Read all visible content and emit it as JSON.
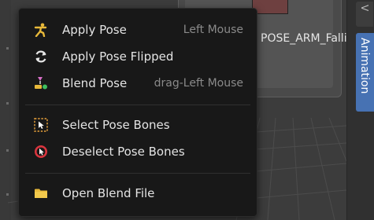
{
  "background": {
    "asset_label": "POSE_ARM_Falling",
    "sidebar_tabs": [
      {
        "label": "V"
      },
      {
        "label": "Animation"
      }
    ]
  },
  "menu": {
    "items": [
      {
        "label": "Apply Pose",
        "shortcut": "Left Mouse",
        "icon": "apply-pose-icon"
      },
      {
        "label": "Apply Pose Flipped",
        "shortcut": "",
        "icon": "flip-icon"
      },
      {
        "label": "Blend Pose",
        "shortcut": "drag-Left Mouse",
        "icon": "blend-pose-icon"
      },
      {
        "label": "Select Pose Bones",
        "shortcut": "",
        "icon": "select-bones-icon"
      },
      {
        "label": "Deselect Pose Bones",
        "shortcut": "",
        "icon": "deselect-bones-icon"
      },
      {
        "label": "Open Blend File",
        "shortcut": "",
        "icon": "folder-icon"
      }
    ]
  },
  "colors": {
    "menu_bg": "#181818",
    "menu_text": "#e4e4e4",
    "shortcut_text": "#8a8a8a",
    "active_tab": "#4772b3",
    "icon_yellow": "#e8b93a",
    "icon_red": "#d9353e"
  }
}
